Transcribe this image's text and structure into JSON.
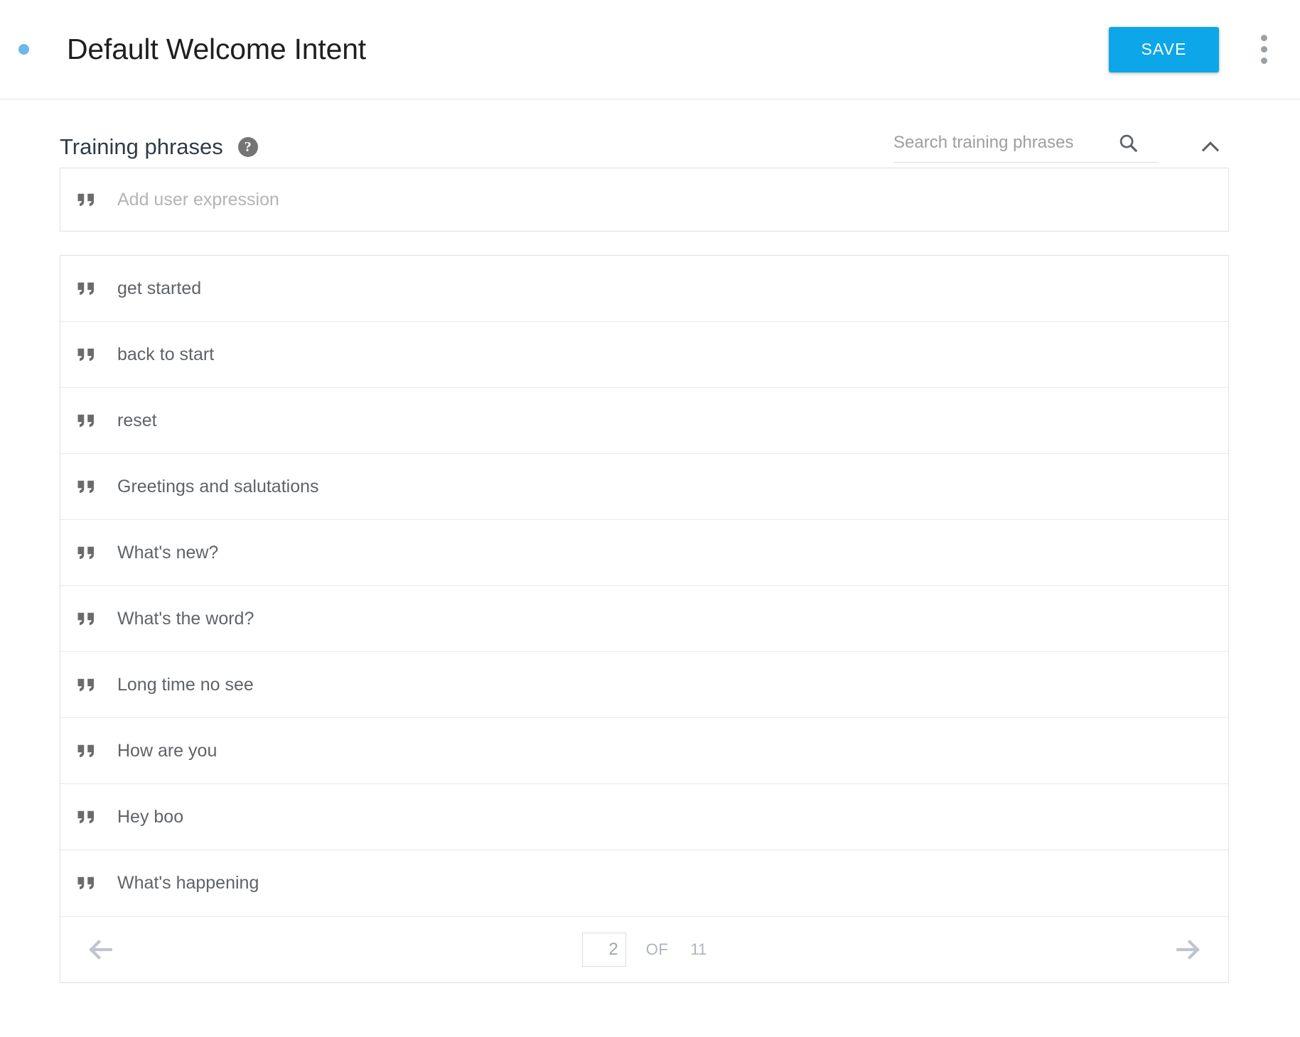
{
  "header": {
    "status_dot_color": "#6cb8ee",
    "intent_title": "Default Welcome Intent",
    "save_label": "SAVE",
    "save_color": "#0ca6e9",
    "overflow_menu_name": "more options"
  },
  "section": {
    "title": "Training phrases",
    "help_tooltip": "?",
    "search_placeholder": "Search training phrases",
    "search_value": ""
  },
  "add_expression": {
    "placeholder": "Add user expression"
  },
  "phrases": [
    {
      "text": "get started"
    },
    {
      "text": "back to start"
    },
    {
      "text": "reset"
    },
    {
      "text": "Greetings and salutations"
    },
    {
      "text": "What's new?"
    },
    {
      "text": "What's the word?"
    },
    {
      "text": "Long time no see"
    },
    {
      "text": "How are you"
    },
    {
      "text": "Hey boo"
    },
    {
      "text": "What's happening"
    }
  ],
  "pagination": {
    "current_page": "2",
    "of_label": "OF",
    "total_pages": "11"
  }
}
